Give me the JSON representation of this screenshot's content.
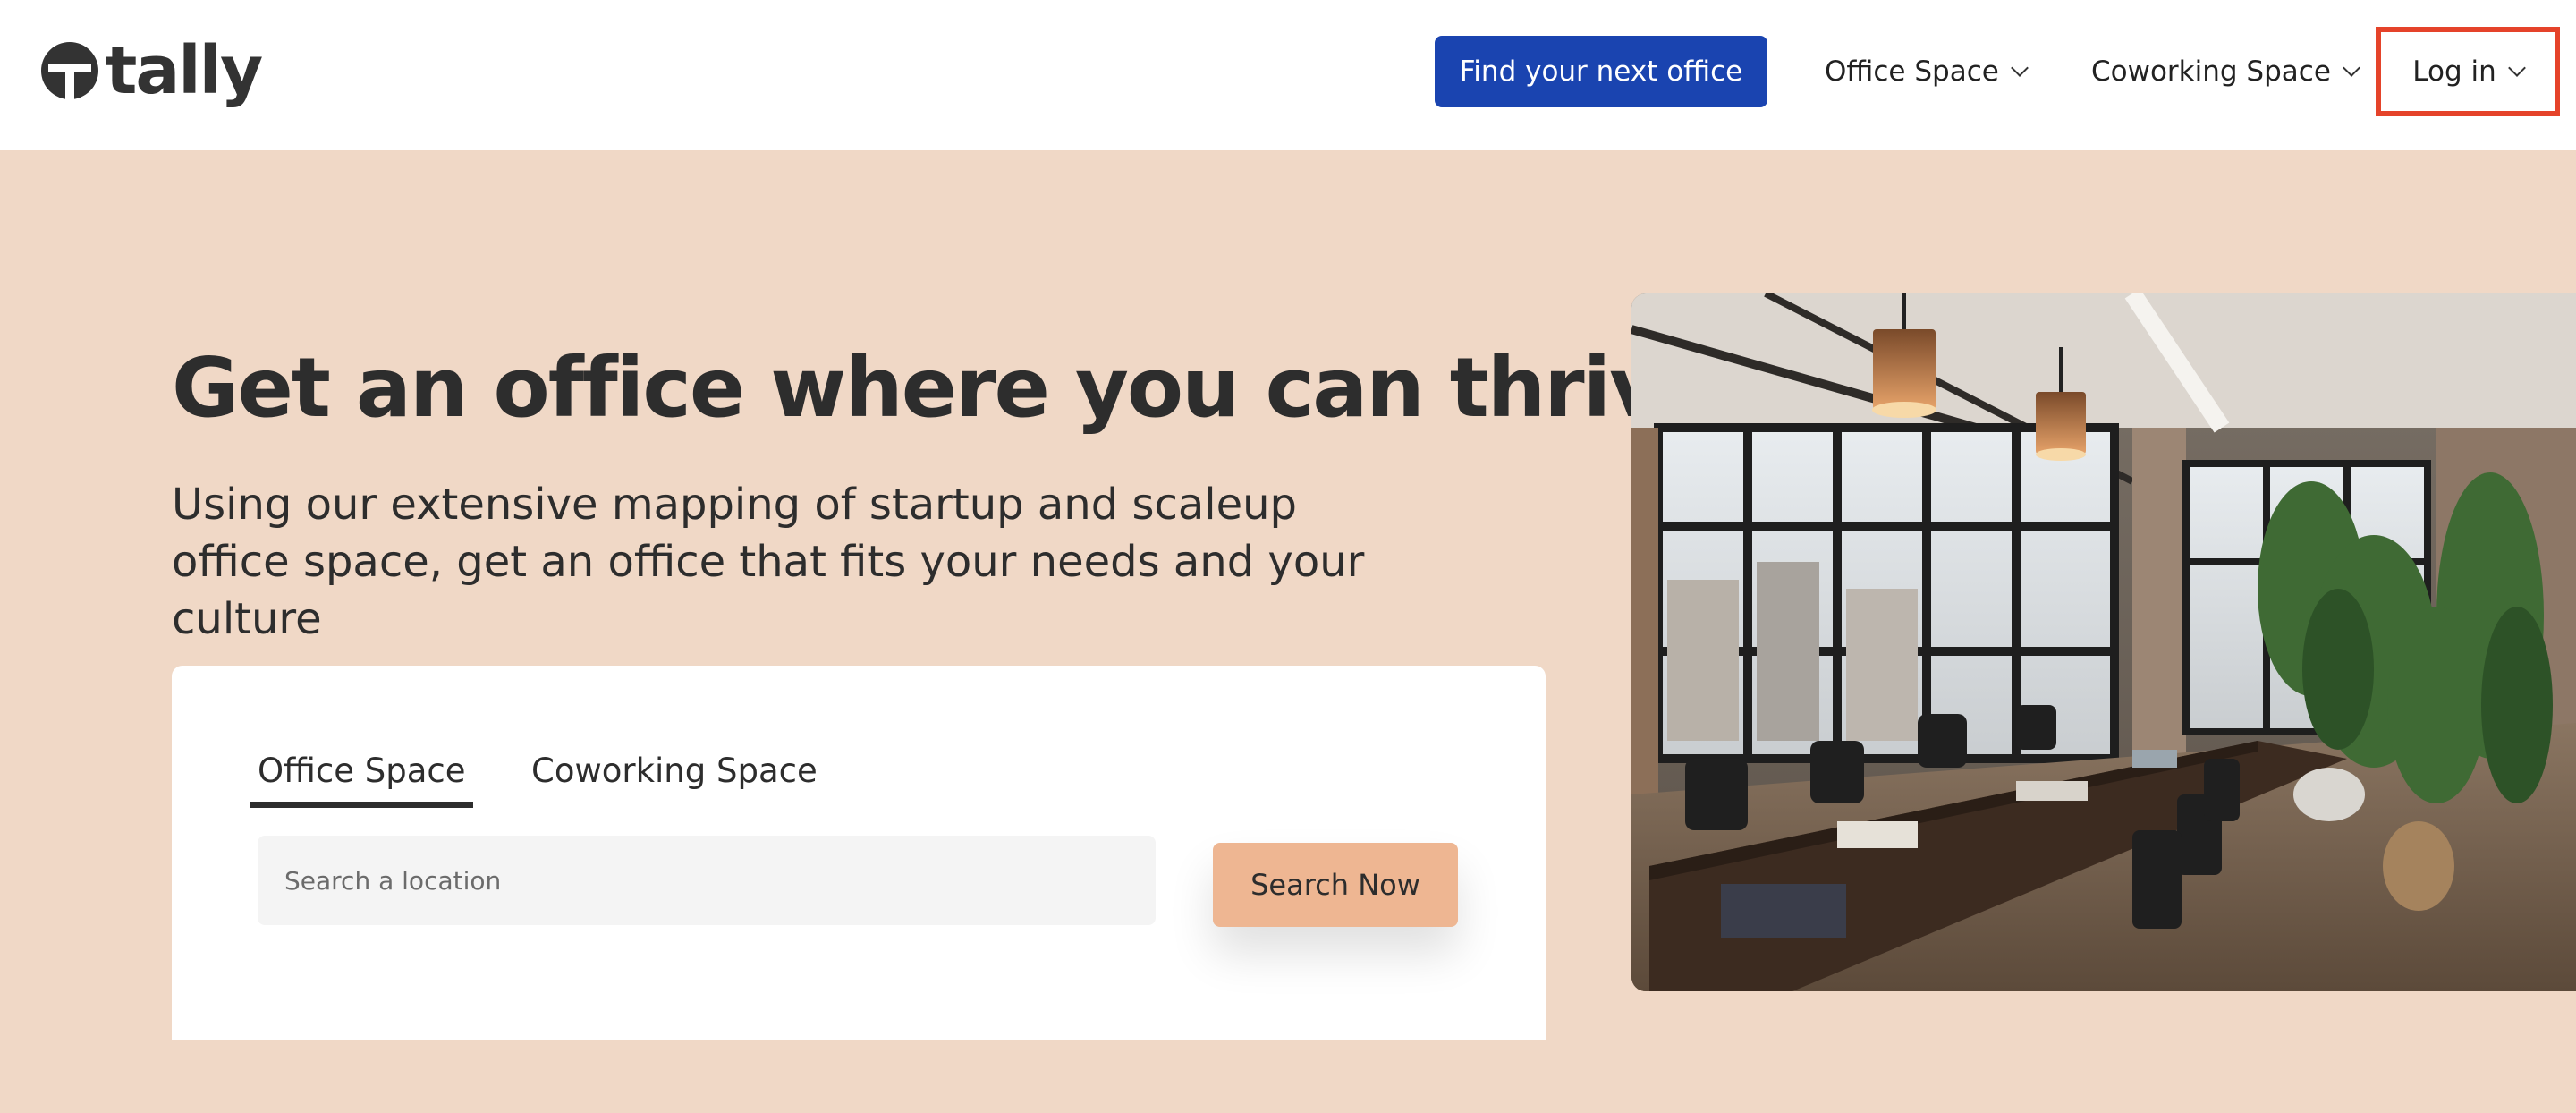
{
  "header": {
    "logo_text": "tally",
    "cta_label": "Find your next office",
    "nav": {
      "office_space": "Office Space",
      "coworking_space": "Coworking Space",
      "login": "Log in"
    }
  },
  "hero": {
    "title": "Get an office where you can thrive",
    "subtitle": "Using our extensive mapping of startup and scaleup office space, get an office that fits your needs and your culture"
  },
  "search": {
    "tabs": [
      "Office Space",
      "Coworking Space"
    ],
    "active_tab": "Office Space",
    "placeholder": "Search a location",
    "button_label": "Search Now"
  },
  "colors": {
    "page_bg": "#f0d8c6",
    "cta_blue": "#1a44b0",
    "search_button": "#eeb692",
    "highlight_border": "#e5432a"
  }
}
